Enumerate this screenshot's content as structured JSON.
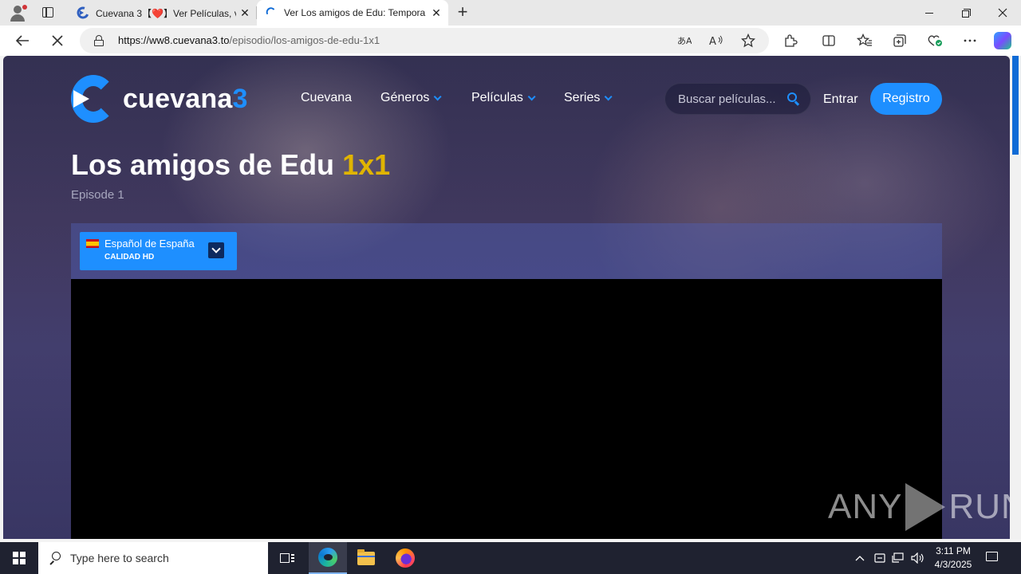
{
  "browser": {
    "tabs": [
      {
        "title": "Cuevana 3【❤️】Ver Películas, ver",
        "active": false
      },
      {
        "title": "Ver Los amigos de Edu: Tempora",
        "active": true
      }
    ],
    "new_tab_glyph": "+",
    "tab_close_glyph": "✕",
    "url_host": "https://ww8.cuevana3.to",
    "url_path": "/episodio/los-amigos-de-edu-1x1",
    "accent": "#0f6bd6"
  },
  "site": {
    "logo_word": "cuevana",
    "logo_number": "3",
    "nav": [
      {
        "label": "Cuevana",
        "dropdown": false
      },
      {
        "label": "Géneros",
        "dropdown": true
      },
      {
        "label": "Películas",
        "dropdown": true
      },
      {
        "label": "Series",
        "dropdown": true
      }
    ],
    "search_placeholder": "Buscar películas...",
    "login_label": "Entrar",
    "register_label": "Registro",
    "brand_color": "#1e8fff",
    "episode_color": "#e0b400"
  },
  "episode": {
    "title": "Los amigos de Edu",
    "code": "1x1",
    "subtitle": "Episode 1"
  },
  "player": {
    "language": "Español de España",
    "quality": "CALIDAD HD"
  },
  "watermark": {
    "left": "ANY",
    "right": "RUN"
  },
  "taskbar": {
    "search_placeholder": "Type here to search",
    "time": "3:11 PM",
    "date": "4/3/2025"
  }
}
